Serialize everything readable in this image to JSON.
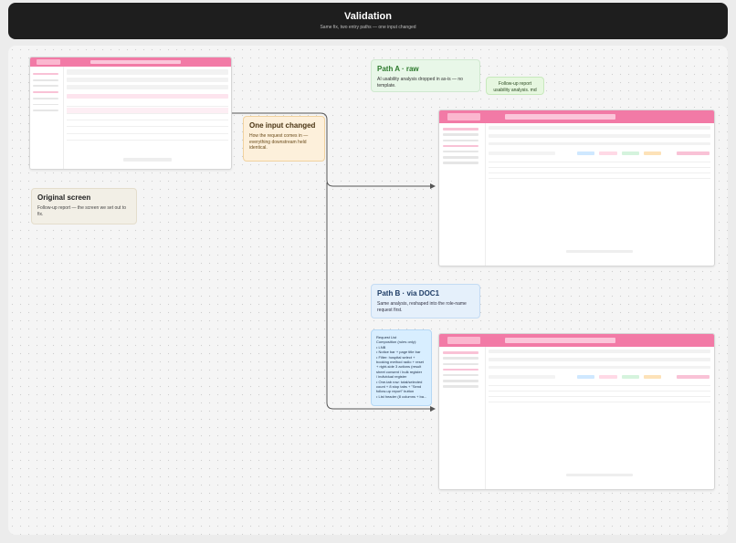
{
  "header": {
    "title": "Validation",
    "subtitle": "Same fix, two entry paths — one input changed"
  },
  "nodes": {
    "path_a": {
      "title": "Path A · raw",
      "body": "AI usability analysis dropped in as-is — no template."
    },
    "followup_doc": {
      "line1": "Follow-up report",
      "line2": "usability analysis. md"
    },
    "one_input": {
      "title": "One input changed",
      "body": "How the request comes in — everything downstream held identical."
    },
    "original": {
      "title": "Original screen",
      "body": "Follow-up report — the screen we set out to fix."
    },
    "path_b": {
      "title": "Path B · via DOC1",
      "body": "Same analysis, reshaped into the role-name request first."
    },
    "request_list": {
      "lines": [
        "Request List",
        "Composition (rules only):",
        "• LNB",
        "• Notice bar + page title bar",
        "• Filter: hospital select +",
        "  booking method radio + reset",
        "  + right-side 3 actions (result",
        "  sheet consent / bulk register",
        "  / individual register",
        "• One-tab row: total/selected",
        "  count + 8 stop tabs + \"Send",
        "  follow-up report\" button",
        "• List header (8 columns + ba..."
      ]
    }
  },
  "colors": {
    "accent": "#f27aa6",
    "edge": "#555555"
  }
}
